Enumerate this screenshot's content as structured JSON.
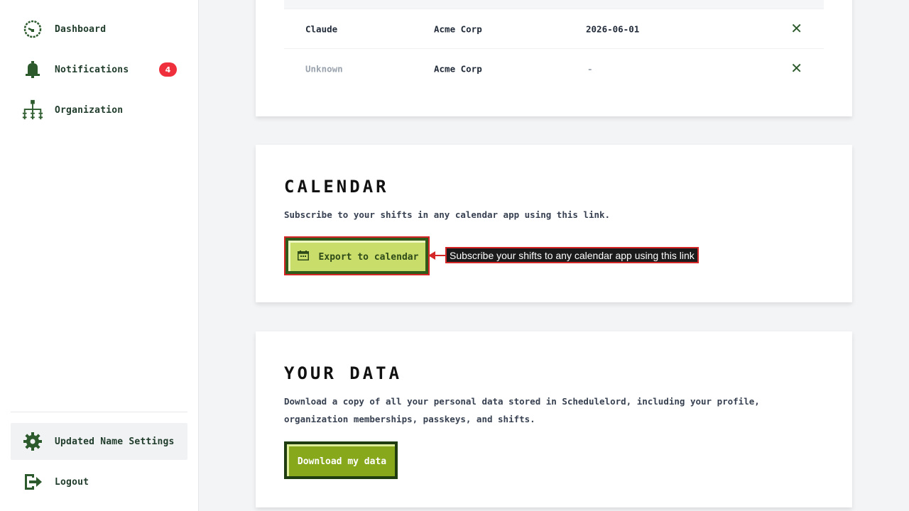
{
  "sidebar": {
    "items": [
      {
        "label": "Dashboard",
        "icon": "dashboard-gauge-icon"
      },
      {
        "label": "Notifications",
        "icon": "bell-icon",
        "badge": "4"
      },
      {
        "label": "Organization",
        "icon": "org-chart-icon"
      }
    ],
    "bottom": [
      {
        "label": "Updated Name Settings",
        "icon": "gear-icon",
        "active": true
      },
      {
        "label": "Logout",
        "icon": "logout-icon"
      }
    ]
  },
  "members_table": {
    "rows": [
      {
        "name": "Claude",
        "organization": "Acme Corp",
        "date": "2026-06-01",
        "remove": "✕"
      },
      {
        "name": "Unknown",
        "organization": "Acme Corp",
        "date": "-",
        "remove": "✕"
      }
    ]
  },
  "calendar": {
    "heading": "CALENDAR",
    "description": "Subscribe to your shifts in any calendar app using this link.",
    "button_label": "Export to calendar",
    "annotation": "Subscribe your shifts to any calendar app using this link"
  },
  "your_data": {
    "heading": "YOUR DATA",
    "description": "Download a copy of all your personal data stored in Schedulelord, including your profile, organization memberships, passkeys, and shifts.",
    "button_label": "Download my data"
  },
  "colors": {
    "accent_green": "#2c5a2c",
    "export_button": "#c9de6a",
    "download_button": "#86a81a",
    "badge_red": "#ef2f3c",
    "annotation_red": "#d42626"
  }
}
